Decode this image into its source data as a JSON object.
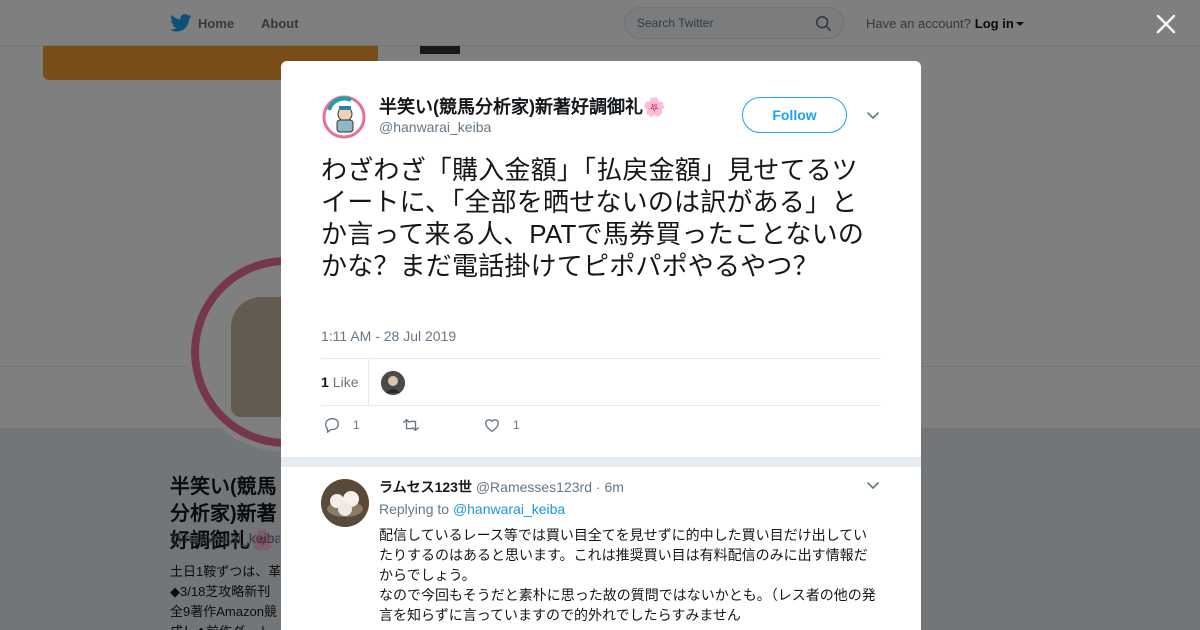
{
  "nav": {
    "home_label": "Home",
    "about_label": "About",
    "search_placeholder": "Search Twitter",
    "account_prompt": "Have an account?",
    "login_label": "Log in"
  },
  "colors": {
    "brand_blue": "#1da1f2",
    "link_blue": "#1b95e0",
    "muted": "#657786",
    "text": "#14171a"
  },
  "background_profile": {
    "name": "半笑い(競馬分析家)新著好調御礼🌸",
    "handle": "@hanwarai_keiba",
    "bio_lines": [
      "土日1鞍ずつは、革",
      "◆3/18芝攻略新刊",
      "全9著作Amazon競",
      "成！◆前作ダート"
    ]
  },
  "tweet": {
    "author_name": "半笑い(競馬分析家)新著好調御礼🌸",
    "author_handle": "@hanwarai_keiba",
    "follow_label": "Follow",
    "text": "わざわざ「購入金額」「払戻金額」見せてるツイートに、「全部を晒せないのは訳がある」とか言って来る人、PATで馬券買ったことないのかな？まだ電話掛けてピポパポやるやつ？",
    "timestamp": "1:11 AM - 28 Jul 2019",
    "like_count": "1",
    "like_label": "Like",
    "actions": {
      "reply_count": "1",
      "retweet_count": "",
      "like_count": "1"
    }
  },
  "reply": {
    "name": "ラムセス123世",
    "handle": "@Ramesses123rd",
    "time": "· 6m",
    "replying_prefix": "Replying to",
    "replying_to": "@hanwarai_keiba",
    "text_lines": [
      "配信しているレース等では買い目全てを見せずに的中した買い目だけ出していたりするのはあると思います。これは推奨買い目は有料配信のみに出す情報だからでしょう。",
      "なので今回もそうだと素朴に思った故の質問ではないかとも。（レス者の他の発言を知らずに言っていますので的外れでしたらすみません"
    ]
  }
}
